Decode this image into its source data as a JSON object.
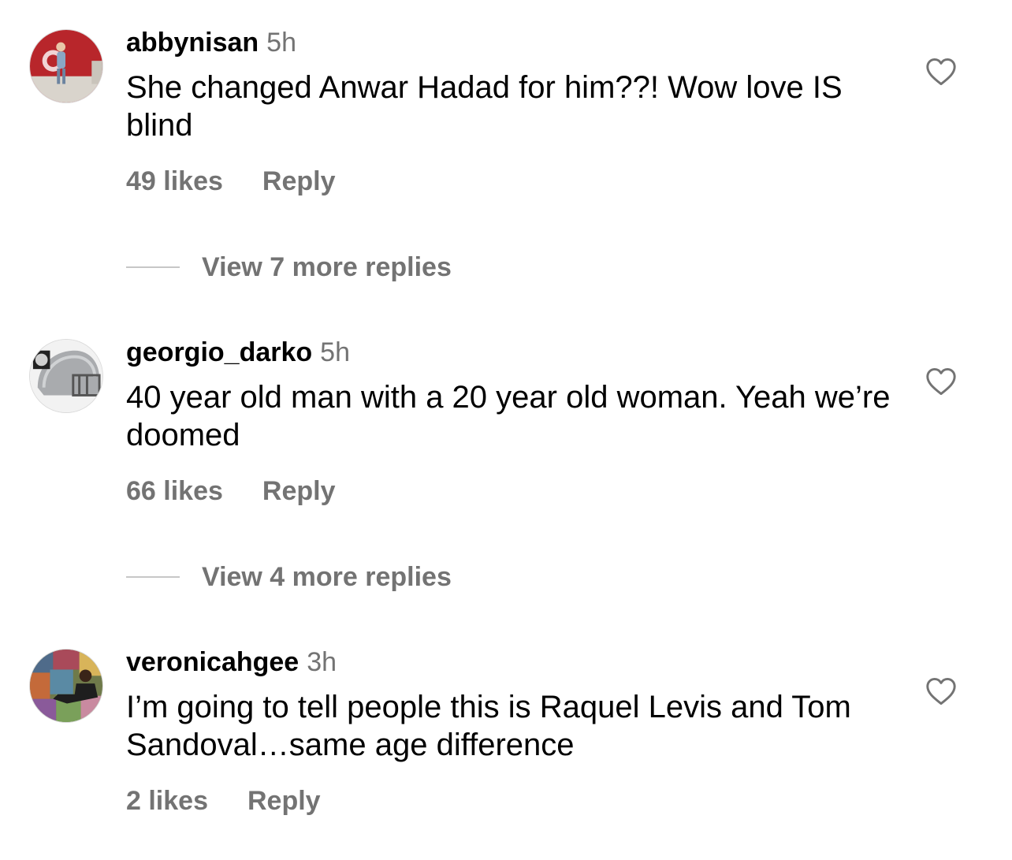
{
  "comments": [
    {
      "username": "abbynisan",
      "time": "5h",
      "text": "She changed Anwar Hadad for him??! Wow love IS blind",
      "likes": "49 likes",
      "reply_label": "Reply",
      "view_replies": "View 7 more replies"
    },
    {
      "username": "georgio_darko",
      "time": "5h",
      "text": "40 year old man with a 20 year old woman. Yeah we’re doomed",
      "likes": "66 likes",
      "reply_label": "Reply",
      "view_replies": "View 4 more replies"
    },
    {
      "username": "veronicahgee",
      "time": "3h",
      "text": "I’m going to tell people this is Raquel Levis and Tom Sandoval…same age difference",
      "likes": "2 likes",
      "reply_label": "Reply"
    }
  ],
  "icons": {
    "like": "heart-outline-icon"
  },
  "colors": {
    "text_primary": "#000000",
    "text_secondary": "#737373",
    "divider": "#c7c7c7"
  }
}
